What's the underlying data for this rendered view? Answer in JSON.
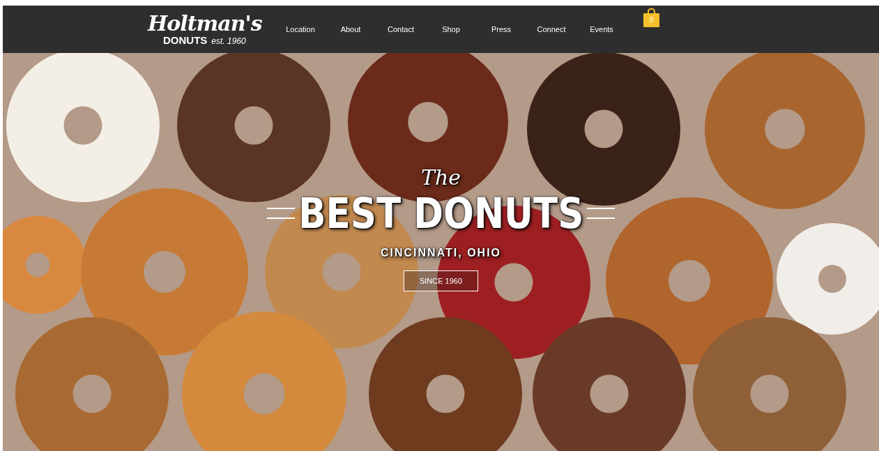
{
  "logo": {
    "name": "Holtman's",
    "subtitle": "DONUTS",
    "established": "est. 1960"
  },
  "nav": [
    {
      "label": "Location"
    },
    {
      "label": "About"
    },
    {
      "label": "Contact"
    },
    {
      "label": "Shop"
    },
    {
      "label": "Press"
    },
    {
      "label": "Connect"
    },
    {
      "label": "Events"
    }
  ],
  "cart": {
    "count": "0"
  },
  "hero": {
    "kicker": "The",
    "headline": "BEST DONUTS",
    "location": "CINCINNATI, OHIO",
    "button": "SINCE 1960"
  }
}
